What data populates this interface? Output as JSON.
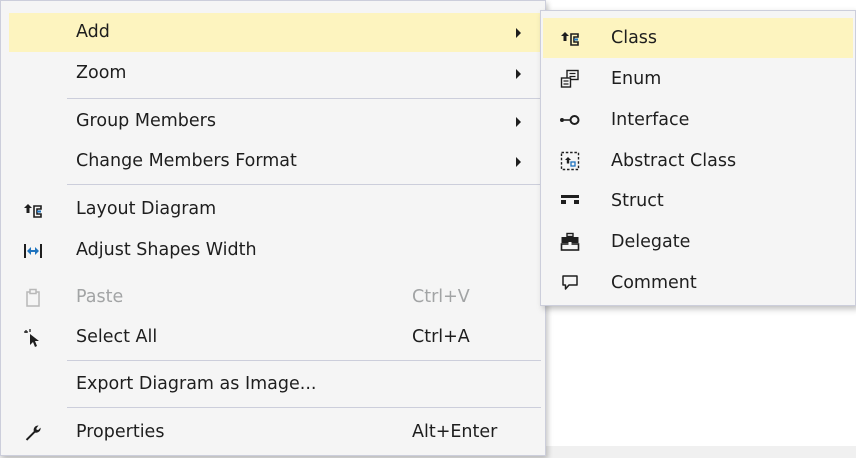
{
  "context_menu": {
    "items": [
      {
        "label": "Add",
        "icon": "none",
        "shortcut": "",
        "has_submenu": true,
        "highlighted": true,
        "enabled": true
      },
      {
        "label": "Zoom",
        "icon": "none",
        "shortcut": "",
        "has_submenu": true,
        "highlighted": false,
        "enabled": true
      },
      {
        "label": "Group Members",
        "icon": "none",
        "shortcut": "",
        "has_submenu": true,
        "highlighted": false,
        "enabled": true
      },
      {
        "label": "Change Members Format",
        "icon": "none",
        "shortcut": "",
        "has_submenu": true,
        "highlighted": false,
        "enabled": true
      },
      {
        "label": "Layout Diagram",
        "icon": "layout-diagram-icon",
        "shortcut": "",
        "has_submenu": false,
        "highlighted": false,
        "enabled": true
      },
      {
        "label": "Adjust Shapes Width",
        "icon": "adjust-width-icon",
        "shortcut": "",
        "has_submenu": false,
        "highlighted": false,
        "enabled": true
      },
      {
        "label": "Paste",
        "icon": "paste-icon",
        "shortcut": "Ctrl+V",
        "has_submenu": false,
        "highlighted": false,
        "enabled": false
      },
      {
        "label": "Select All",
        "icon": "select-all-icon",
        "shortcut": "Ctrl+A",
        "has_submenu": false,
        "highlighted": false,
        "enabled": true
      },
      {
        "label": "Export Diagram as Image...",
        "icon": "none",
        "shortcut": "",
        "has_submenu": false,
        "highlighted": false,
        "enabled": true
      },
      {
        "label": "Properties",
        "icon": "wrench-icon",
        "shortcut": "Alt+Enter",
        "has_submenu": false,
        "highlighted": false,
        "enabled": true
      }
    ]
  },
  "add_submenu": {
    "items": [
      {
        "label": "Class",
        "icon": "class-icon",
        "highlighted": true
      },
      {
        "label": "Enum",
        "icon": "enum-icon",
        "highlighted": false
      },
      {
        "label": "Interface",
        "icon": "interface-icon",
        "highlighted": false
      },
      {
        "label": "Abstract Class",
        "icon": "abstract-class-icon",
        "highlighted": false
      },
      {
        "label": "Struct",
        "icon": "struct-icon",
        "highlighted": false
      },
      {
        "label": "Delegate",
        "icon": "delegate-icon",
        "highlighted": false
      },
      {
        "label": "Comment",
        "icon": "comment-icon",
        "highlighted": false
      }
    ]
  },
  "colors": {
    "menu_background": "#f5f5f5",
    "highlight": "#fdf4bf",
    "border": "#cccedb",
    "text": "#1e1e1e",
    "disabled_text": "#a2a4a5",
    "icon": "#424242",
    "accent_blue": "#1e73be"
  }
}
